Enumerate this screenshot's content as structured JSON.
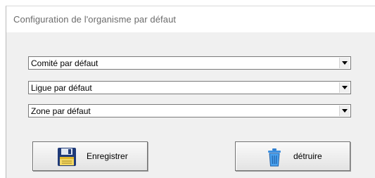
{
  "window": {
    "title": "Configuration de l'organisme par défaut"
  },
  "selects": {
    "comite": {
      "value": "Comité par défaut"
    },
    "ligue": {
      "value": "Ligue par défaut"
    },
    "zone": {
      "value": "Zone par défaut"
    }
  },
  "buttons": {
    "save_label": "Enregistrer",
    "delete_label": "détruire",
    "save_icon": "floppy-disk-icon",
    "delete_icon": "trash-can-icon"
  }
}
